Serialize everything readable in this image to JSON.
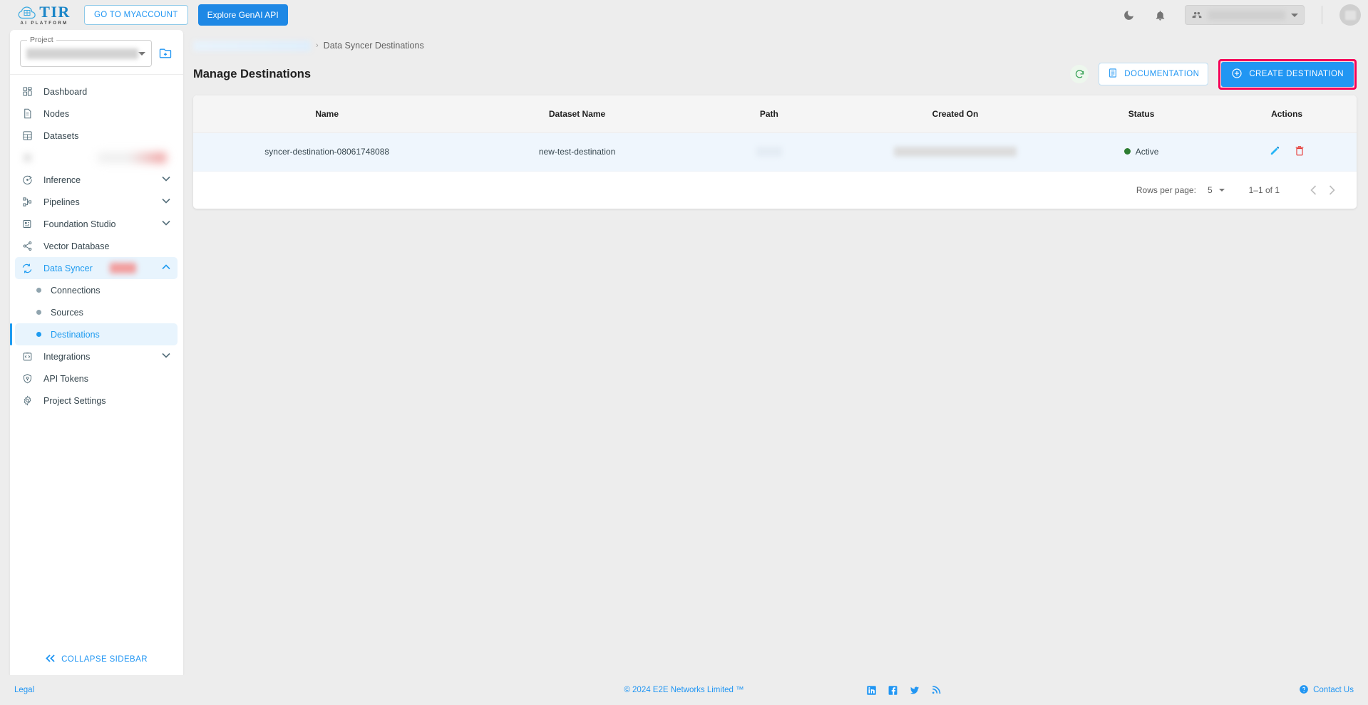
{
  "header": {
    "logo_title": "TIR",
    "logo_subtitle": "AI PLATFORM",
    "myaccount_label": "GO TO MYACCOUNT",
    "genai_label": "Explore GenAI API",
    "dark_mode_icon": "moon-icon",
    "notifications_icon": "bell-icon",
    "account_select_icon": "people-icon",
    "account_select_value": "",
    "avatar_label": ""
  },
  "sidebar": {
    "project_label": "Project",
    "project_value": "",
    "create_project_icon": "folder-add-icon",
    "items": [
      {
        "label": "Dashboard",
        "icon": "dashboard-icon",
        "type": "item",
        "expandable": false,
        "active": false
      },
      {
        "label": "Nodes",
        "icon": "node-document-icon",
        "type": "item",
        "expandable": false,
        "active": false
      },
      {
        "label": "Datasets",
        "icon": "datasets-grid-icon",
        "type": "item",
        "expandable": false,
        "active": false
      },
      {
        "label": "",
        "icon": "hidden-icon",
        "type": "item-blurred",
        "expandable": false,
        "active": false,
        "badge": ""
      },
      {
        "label": "Inference",
        "icon": "inference-icon",
        "type": "item",
        "expandable": true,
        "active": false
      },
      {
        "label": "Pipelines",
        "icon": "pipelines-icon",
        "type": "item",
        "expandable": true,
        "active": false
      },
      {
        "label": "Foundation Studio",
        "icon": "foundation-studio-icon",
        "type": "item",
        "expandable": true,
        "active": false
      },
      {
        "label": "Vector Database",
        "icon": "vector-database-icon",
        "type": "item",
        "expandable": false,
        "active": false
      },
      {
        "label": "Data Syncer",
        "icon": "data-syncer-icon",
        "type": "item",
        "expandable": true,
        "active": true,
        "badge": ""
      },
      {
        "label": "Connections",
        "icon": "bullet-dot",
        "type": "subitem",
        "expandable": false,
        "active": false
      },
      {
        "label": "Sources",
        "icon": "bullet-dot",
        "type": "subitem",
        "expandable": false,
        "active": false
      },
      {
        "label": "Destinations",
        "icon": "bullet-dot",
        "type": "subitem",
        "expandable": false,
        "active": true
      },
      {
        "label": "Integrations",
        "icon": "integrations-icon",
        "type": "item",
        "expandable": true,
        "active": false
      },
      {
        "label": "API Tokens",
        "icon": "api-tokens-icon",
        "type": "item",
        "expandable": false,
        "active": false
      },
      {
        "label": "Project Settings",
        "icon": "gear-icon",
        "type": "item",
        "expandable": false,
        "active": false
      }
    ],
    "collapse_label": "COLLAPSE SIDEBAR",
    "collapse_icon": "double-chevron-left-icon"
  },
  "breadcrumb": {
    "first_segment": "",
    "separator": "›",
    "current": "Data Syncer Destinations"
  },
  "page": {
    "title": "Manage Destinations",
    "refresh_icon": "refresh-icon",
    "documentation_label": "DOCUMENTATION",
    "documentation_icon": "book-icon",
    "create_label": "CREATE DESTINATION",
    "create_icon": "plus-circle-icon"
  },
  "table": {
    "columns": [
      "Name",
      "Dataset Name",
      "Path",
      "Created On",
      "Status",
      "Actions"
    ],
    "rows": [
      {
        "name": "syncer-destination-08061748088",
        "dataset_name": "new-test-destination",
        "path": "",
        "created_on": "",
        "status": "Active",
        "status_color": "#2e7d32",
        "edit_icon": "pencil-icon",
        "delete_icon": "trash-icon"
      }
    ]
  },
  "pagination": {
    "rows_per_page_label": "Rows per page:",
    "rows_per_page_value": "5",
    "range_label": "1–1 of 1",
    "prev_icon": "chevron-left-icon",
    "next_icon": "chevron-right-icon"
  },
  "footer": {
    "legal_label": "Legal",
    "copyright": "© 2024 E2E Networks Limited ™",
    "socials": [
      "linkedin-icon",
      "facebook-icon",
      "twitter-icon",
      "rss-icon"
    ],
    "contact_label": "Contact Us",
    "contact_icon": "help-circle-icon"
  },
  "colors": {
    "brand_blue": "#2196f3",
    "accent_blue": "#1e9bf0",
    "highlight_pink": "#f50057",
    "status_green": "#2e7d32",
    "delete_red": "#e53935",
    "page_bg": "#ededed"
  }
}
